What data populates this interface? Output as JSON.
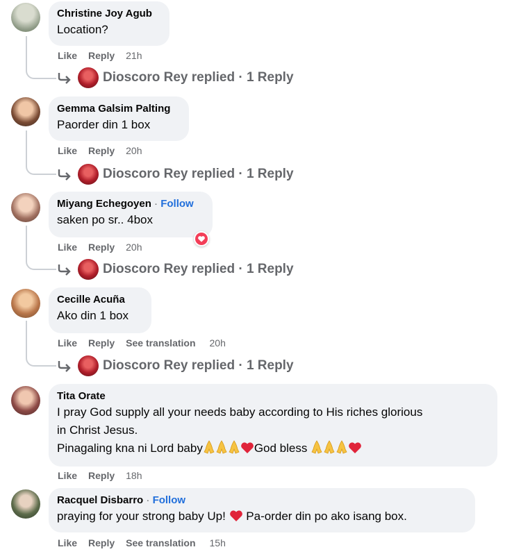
{
  "comments": [
    {
      "author": "Christine Joy Agub",
      "text": "Location?",
      "like": "Like",
      "reply": "Reply",
      "time": "21h",
      "reply_summary": "Dioscoro Rey replied · 1 Reply"
    },
    {
      "author": "Gemma Galsim Palting",
      "text": "Paorder din 1 box",
      "like": "Like",
      "reply": "Reply",
      "time": "20h",
      "reply_summary": "Dioscoro Rey replied · 1 Reply"
    },
    {
      "author": "Miyang Echegoyen",
      "follow": "Follow",
      "separator": "·",
      "text": "saken po sr.. 4box",
      "like": "Like",
      "reply": "Reply",
      "time": "20h",
      "reply_summary": "Dioscoro Rey replied · 1 Reply",
      "reaction_icon": "heart-icon"
    },
    {
      "author": "Cecille Acuña",
      "text": "Ako din 1 box",
      "like": "Like",
      "reply": "Reply",
      "translate": "See translation",
      "time": "20h",
      "reply_summary": "Dioscoro Rey replied · 1 Reply"
    },
    {
      "author": "Tita Orate",
      "text_line1": "I pray God supply all your needs baby according to His riches glorious",
      "text_line2": "in Christ Jesus.",
      "text_line3_a": "Pinagaling kna ni Lord baby",
      "text_line3_b": "God bless ",
      "like": "Like",
      "reply": "Reply",
      "time": "18h"
    },
    {
      "author": "Racquel Disbarro",
      "follow": "Follow",
      "separator": "·",
      "text_a": "praying for your strong baby Up! ",
      "text_b": " Pa-order din po ako isang box.",
      "like": "Like",
      "reply": "Reply",
      "translate": "See translation",
      "time": "15h"
    }
  ],
  "colors": {
    "bubble": "#f0f2f5",
    "meta": "#65676b",
    "link": "#216fdb",
    "heart": "#f33e58",
    "pray": "#f6c342"
  }
}
